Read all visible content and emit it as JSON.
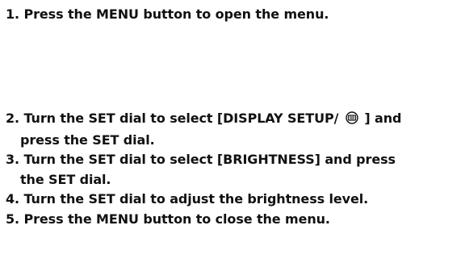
{
  "steps": [
    {
      "number": "1.",
      "text": "Press the MENU button to open the menu."
    },
    {
      "number": "2.",
      "text_before_icon": "Turn the SET dial to select [DISPLAY SETUP/",
      "icon": "display-setup-icon",
      "text_after_icon": "] and",
      "continuation": "press the SET dial."
    },
    {
      "number": "3.",
      "text": "Turn the SET dial to select [BRIGHTNESS] and press",
      "continuation": "the SET dial."
    },
    {
      "number": "4.",
      "text": "Turn the SET dial to adjust the brightness level."
    },
    {
      "number": "5.",
      "text": "Press the MENU button to close the menu."
    }
  ]
}
